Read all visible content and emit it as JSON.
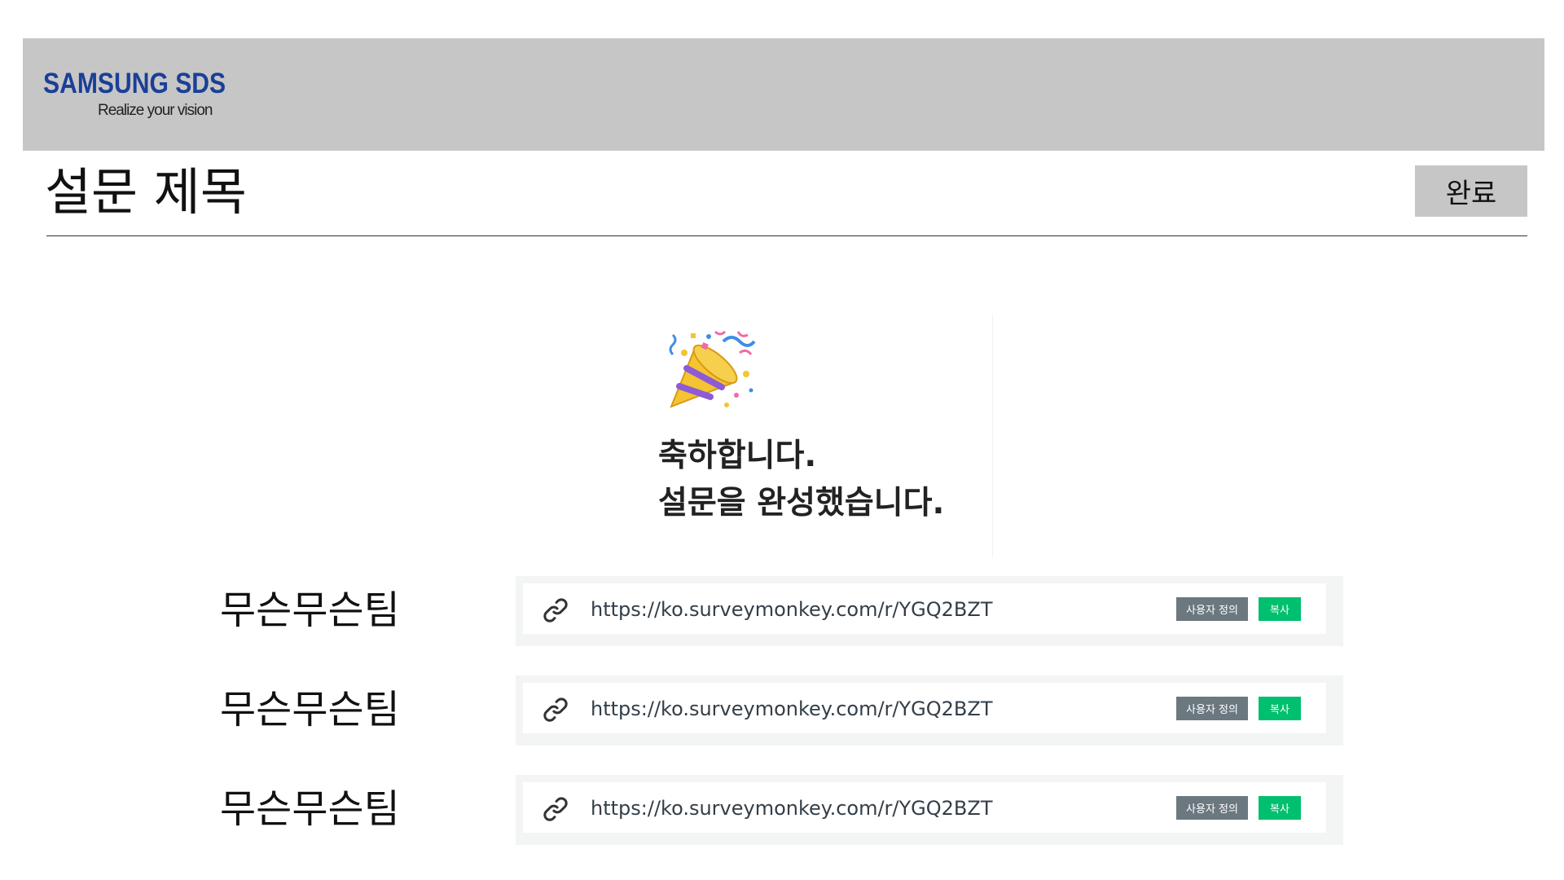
{
  "header": {
    "brand": "SAMSUNG SDS",
    "tagline": "Realize your vision",
    "brand_color": "#1a3f98",
    "background_color": "#c6c6c6"
  },
  "survey": {
    "title": "설문 제목",
    "done_label": "완료"
  },
  "congrats": {
    "icon": "party-popper-icon",
    "line1": "축하합니다.",
    "line2": "설문을 완성했습니다."
  },
  "links": [
    {
      "team": "무슨무슨팀",
      "url": "https://ko.surveymonkey.com/r/YGQ2BZT",
      "custom_label": "사용자 정의",
      "copy_label": "복사"
    },
    {
      "team": "무슨무슨팀",
      "url": "https://ko.surveymonkey.com/r/YGQ2BZT",
      "custom_label": "사용자 정의",
      "copy_label": "복사"
    },
    {
      "team": "무슨무슨팀",
      "url": "https://ko.surveymonkey.com/r/YGQ2BZT",
      "custom_label": "사용자 정의",
      "copy_label": "복사"
    }
  ],
  "colors": {
    "copy_button": "#00bf6f",
    "custom_button": "#6b787f",
    "link_box_border": "#f3f4f4"
  }
}
